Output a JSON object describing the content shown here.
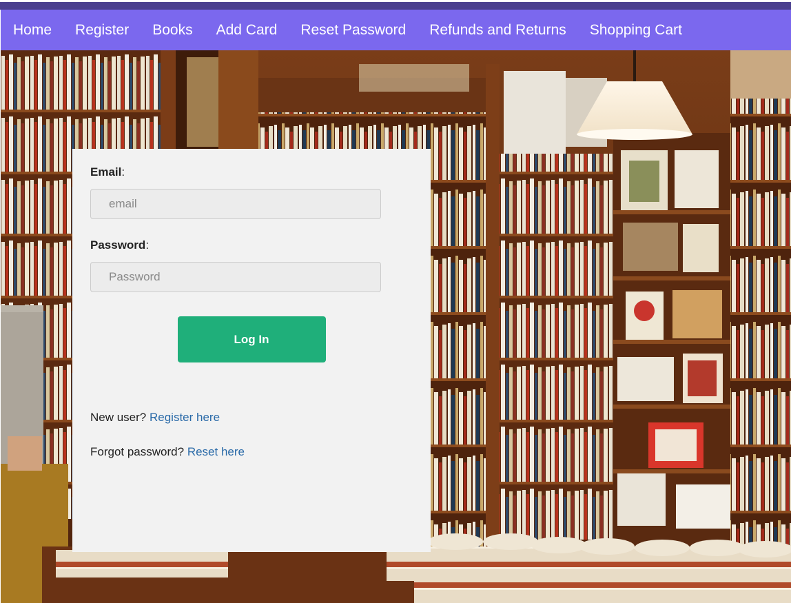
{
  "nav": {
    "items": [
      {
        "label": "Home"
      },
      {
        "label": "Register"
      },
      {
        "label": "Books"
      },
      {
        "label": "Add Card"
      },
      {
        "label": "Reset Password"
      },
      {
        "label": "Refunds and Returns"
      },
      {
        "label": "Shopping Cart"
      }
    ]
  },
  "login": {
    "email_label": "Email",
    "email_placeholder": "email",
    "password_label": "Password",
    "password_placeholder": "Password",
    "submit_label": "Log In",
    "new_user_text": "New user?",
    "register_link": "Register here",
    "forgot_text": "Forgot password?",
    "reset_link": "Reset here"
  },
  "colors": {
    "nav_bg": "#7b68ee",
    "button_bg": "#1faf7a",
    "link": "#2a6aa8",
    "card_bg": "#f2f2f2"
  }
}
